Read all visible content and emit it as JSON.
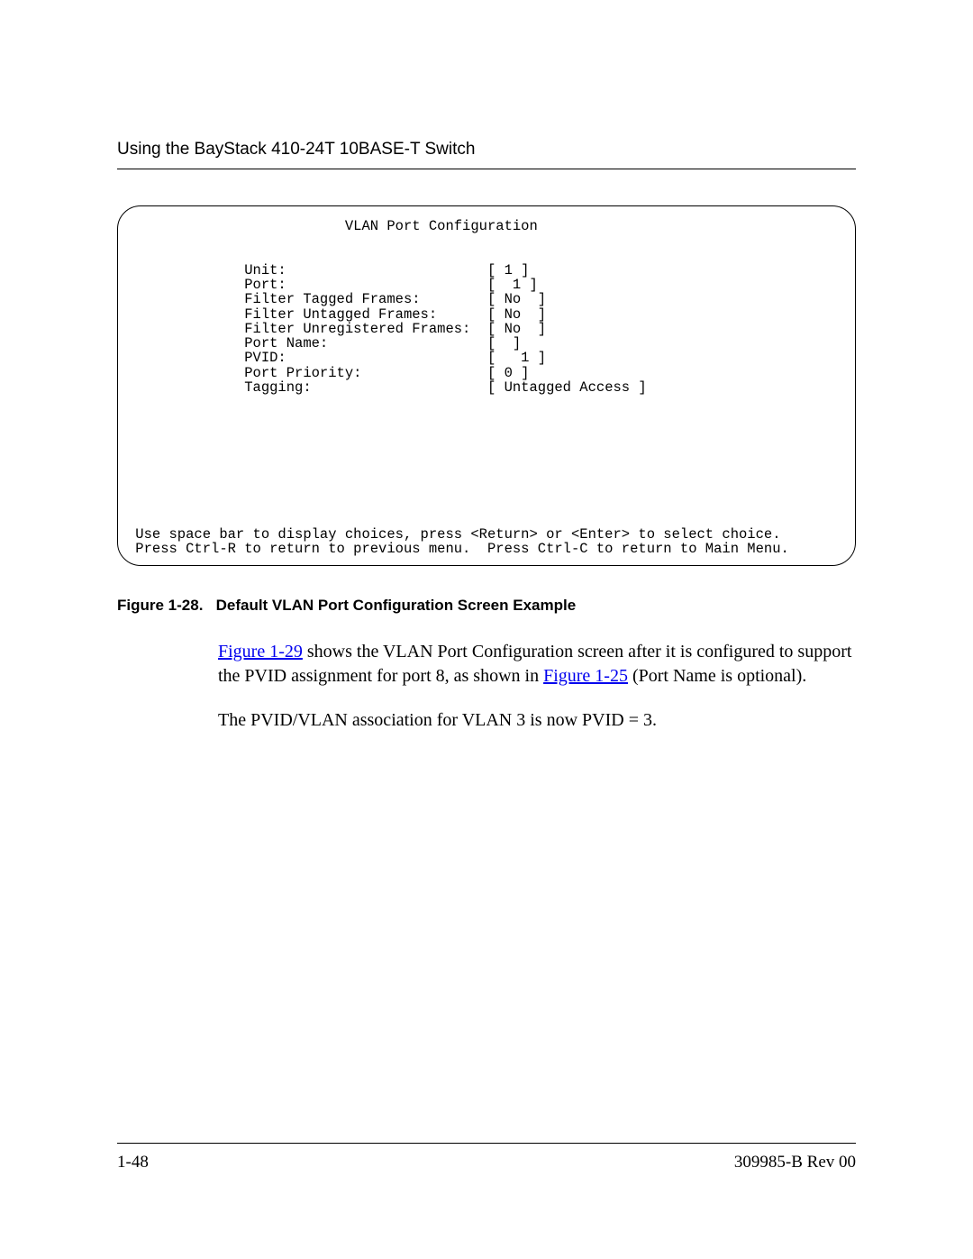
{
  "header": {
    "title": "Using the BayStack 410-24T 10BASE-T Switch"
  },
  "terminal": {
    "title": "                          VLAN Port Configuration",
    "rows": [
      {
        "label": "              Unit:                        ",
        "value": "[ 1 ]"
      },
      {
        "label": "              Port:                        ",
        "value": "[  1 ]"
      },
      {
        "label": "              Filter Tagged Frames:        ",
        "value": "[ No  ]"
      },
      {
        "label": "              Filter Untagged Frames:      ",
        "value": "[ No  ]"
      },
      {
        "label": "              Filter Unregistered Frames:  ",
        "value": "[ No  ]"
      },
      {
        "label": "              Port Name:                   ",
        "value": "[  ]"
      },
      {
        "label": "              PVID:                        ",
        "value": "[   1 ]"
      },
      {
        "label": "              Port Priority:               ",
        "value": "[ 0 ]"
      },
      {
        "label": "              Tagging:                     ",
        "value": "[ Untagged Access ]"
      }
    ],
    "help1": " Use space bar to display choices, press <Return> or <Enter> to select choice.",
    "help2": " Press Ctrl-R to return to previous menu.  Press Ctrl-C to return to Main Menu."
  },
  "figure": {
    "label": "Figure 1-28.",
    "caption": "Default VLAN Port Configuration Screen Example"
  },
  "para1": {
    "link1": "Figure 1-29",
    "seg1": " shows the VLAN Port Configuration screen after it is configured to support the PVID assignment for port 8, as shown in ",
    "link2": "Figure 1-25",
    "seg2": " (Port Name is optional)."
  },
  "para2": "The PVID/VLAN association for VLAN 3 is now PVID = 3.",
  "footer": {
    "page": "1-48",
    "doc": "309985-B Rev 00"
  }
}
